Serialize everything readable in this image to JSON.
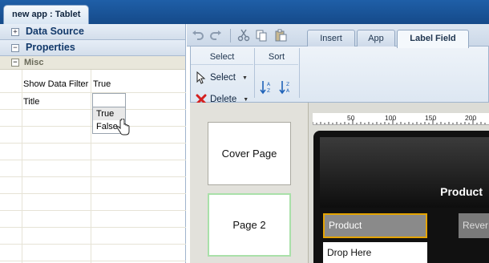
{
  "window": {
    "tab_title": "new app : Tablet"
  },
  "left_panel": {
    "sections": [
      {
        "label": "Data Source",
        "state": "collapsed",
        "symbol": "+"
      },
      {
        "label": "Properties",
        "state": "expanded",
        "symbol": "−"
      }
    ],
    "category": {
      "label": "Misc",
      "symbol": "−"
    },
    "properties": [
      {
        "name": "Show Data Filter",
        "value": "True"
      },
      {
        "name": "Title",
        "value": ""
      }
    ],
    "dropdown": {
      "options": [
        "True",
        "False"
      ],
      "highlighted": "True"
    }
  },
  "toolbar": {
    "icons": [
      "undo-icon",
      "redo-icon",
      "cut-icon",
      "copy-icon",
      "paste-icon"
    ],
    "tabs": [
      {
        "label": "Insert",
        "active": false
      },
      {
        "label": "App",
        "active": false
      },
      {
        "label": "Label Field",
        "active": true
      }
    ]
  },
  "ribbon": {
    "groups": [
      {
        "title": "Select",
        "buttons": [
          {
            "label": "Select",
            "icon": "pointer-icon"
          },
          {
            "label": "Delete",
            "icon": "delete-x-icon"
          }
        ]
      },
      {
        "title": "Sort",
        "buttons": [
          {
            "icon": "sort-ascending-icon"
          },
          {
            "icon": "sort-descending-icon"
          }
        ]
      }
    ]
  },
  "pages": [
    {
      "label": "Cover Page",
      "selected": false
    },
    {
      "label": "Page 2",
      "selected": true
    }
  ],
  "canvas": {
    "ruler_ticks": [
      "50",
      "100",
      "150",
      "200"
    ],
    "header_title": "Product",
    "fields": [
      {
        "label": "Product",
        "selected": true
      },
      {
        "label": "Rever",
        "selected": false
      }
    ],
    "drop_target": "Drop Here"
  },
  "colors": {
    "title_bar": "#1f5fa8",
    "accent_selected": "#e5a400",
    "delete_red": "#d42020",
    "selected_page_border": "#a9e0a9"
  }
}
